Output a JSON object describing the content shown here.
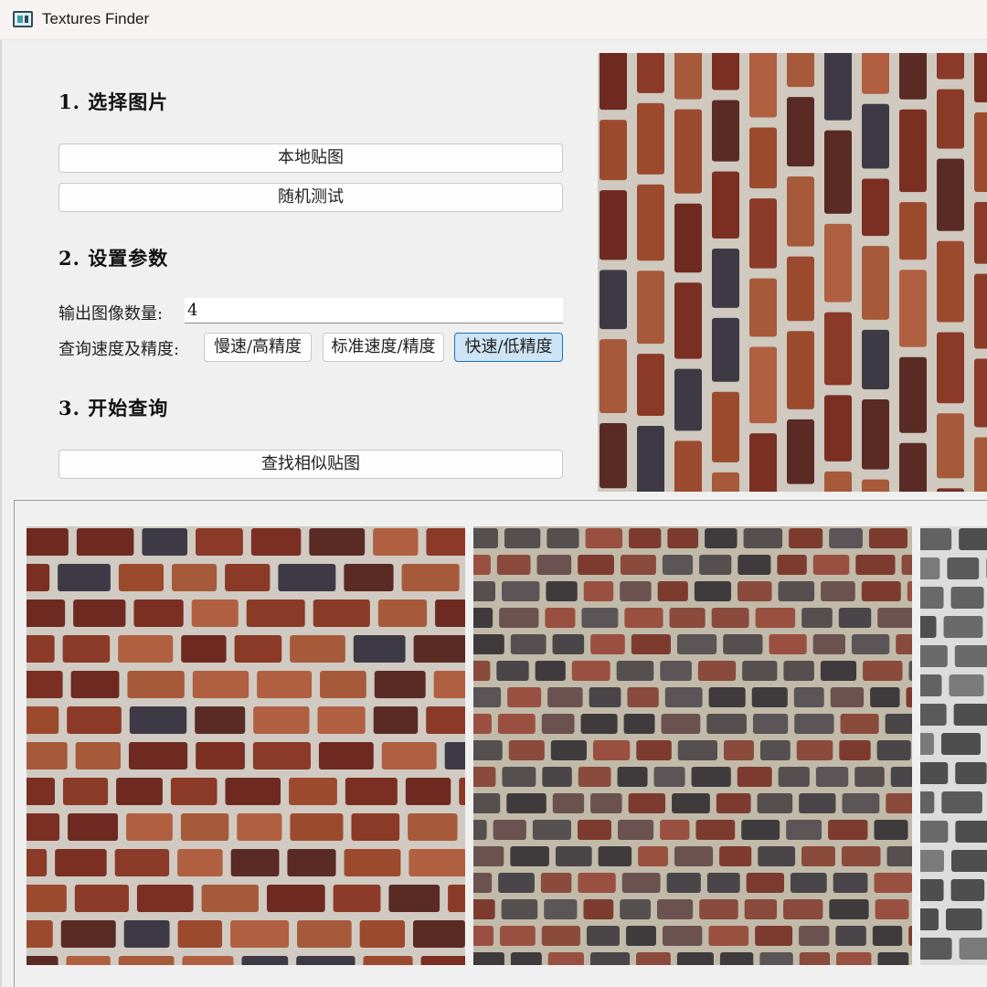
{
  "window": {
    "title": "Textures Finder",
    "icon": "app-icon"
  },
  "steps": {
    "select": {
      "heading": "1.  选择图片",
      "local_button": "本地贴图",
      "random_button": "随机测试"
    },
    "params": {
      "heading": "2.  设置参数",
      "count_label": "输出图像数量:",
      "count_value": "4",
      "speed_label": "查询速度及精度:",
      "speed_options": [
        "慢速/高精度",
        "标准速度/精度",
        "快速/低精度"
      ],
      "speed_selected": "快速/低精度"
    },
    "search": {
      "heading": "3.  开始查询",
      "find_button": "查找相似贴图"
    }
  },
  "colors": {
    "accent_selected_bg": "#cde4f7",
    "accent_selected_border": "#1c72c4",
    "brick_red": "#8a3a26",
    "brick_dark": "#4a4548",
    "mortar": "#c9c3b9"
  }
}
